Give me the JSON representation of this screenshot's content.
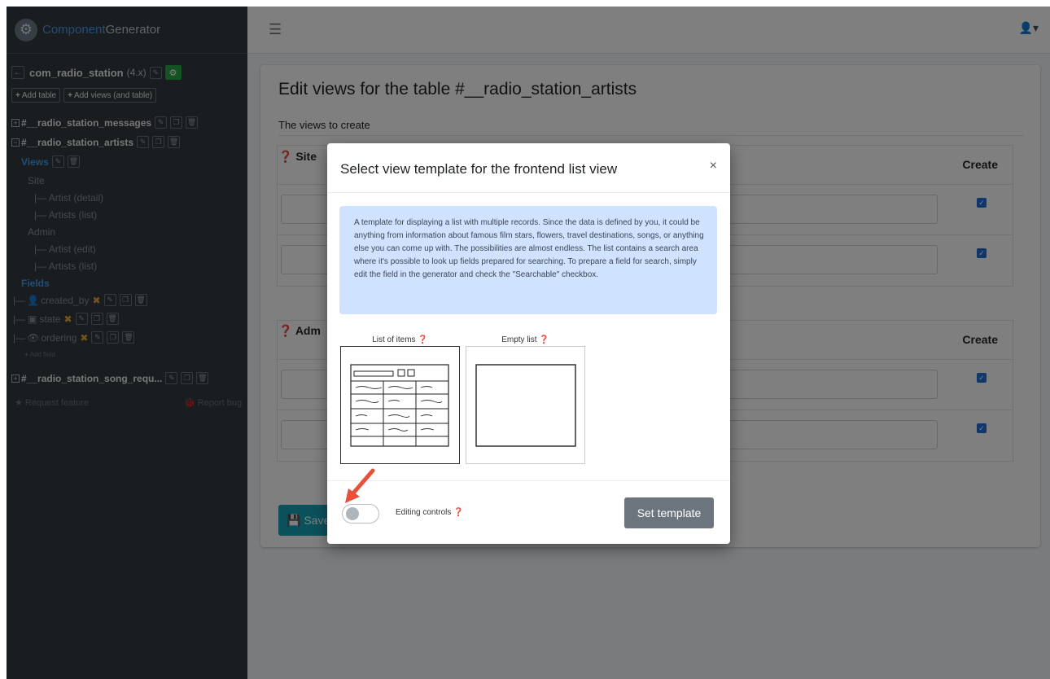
{
  "brand": {
    "part1": "Component",
    "part2": "Generator"
  },
  "sidebar": {
    "component": "com_radio_station",
    "version": "(4.x)",
    "add_table": "Add table",
    "add_views": "Add views (and table)",
    "tables": [
      {
        "name": "#__radio_station_messages",
        "expand": "+"
      },
      {
        "name": "#__radio_station_artists",
        "expand": "−"
      },
      {
        "name": "#__radio_station_song_requ...",
        "expand": "+"
      }
    ],
    "views_label": "Views",
    "site_label": "Site",
    "site_views": [
      "|— Artist (detail)",
      "|— Artists (list)"
    ],
    "admin_label": "Admin",
    "admin_views": [
      "|— Artist (edit)",
      "|— Artists (list)"
    ],
    "fields_label": "Fields",
    "fields": [
      "created_by",
      "state",
      "ordering"
    ],
    "field_prefix": "|—",
    "add_field": "Add field",
    "request_feature": "Request feature",
    "report_bug": "Report bug"
  },
  "main": {
    "title": "Edit views for the table #__radio_station_artists",
    "subtitle": "The views to create",
    "site_section": "Site",
    "admin_section": "Adm",
    "create_col": "Create",
    "save_label": "Save"
  },
  "modal": {
    "title": "Select view template for the frontend list view",
    "close": "×",
    "description": "A template for displaying a list with multiple records. Since the data is defined by you, it could be anything from information about famous film stars, flowers, travel destinations, songs, or anything else you can come up with. The possibilities are almost endless. The list contains a search area where it's possible to look up fields prepared for searching. To prepare a field for search, simply edit the field in the generator and check the \"Searchable\" checkbox.",
    "templates": [
      {
        "label": "List of items",
        "selected": true
      },
      {
        "label": "Empty list",
        "selected": false
      }
    ],
    "toggle_label": "Editing controls",
    "set_button": "Set template"
  },
  "colors": {
    "accent": "#3f9cf3",
    "sidebar_bg": "#343a40",
    "info_bg": "#cfe2ff",
    "arrow": "#e8503a"
  }
}
